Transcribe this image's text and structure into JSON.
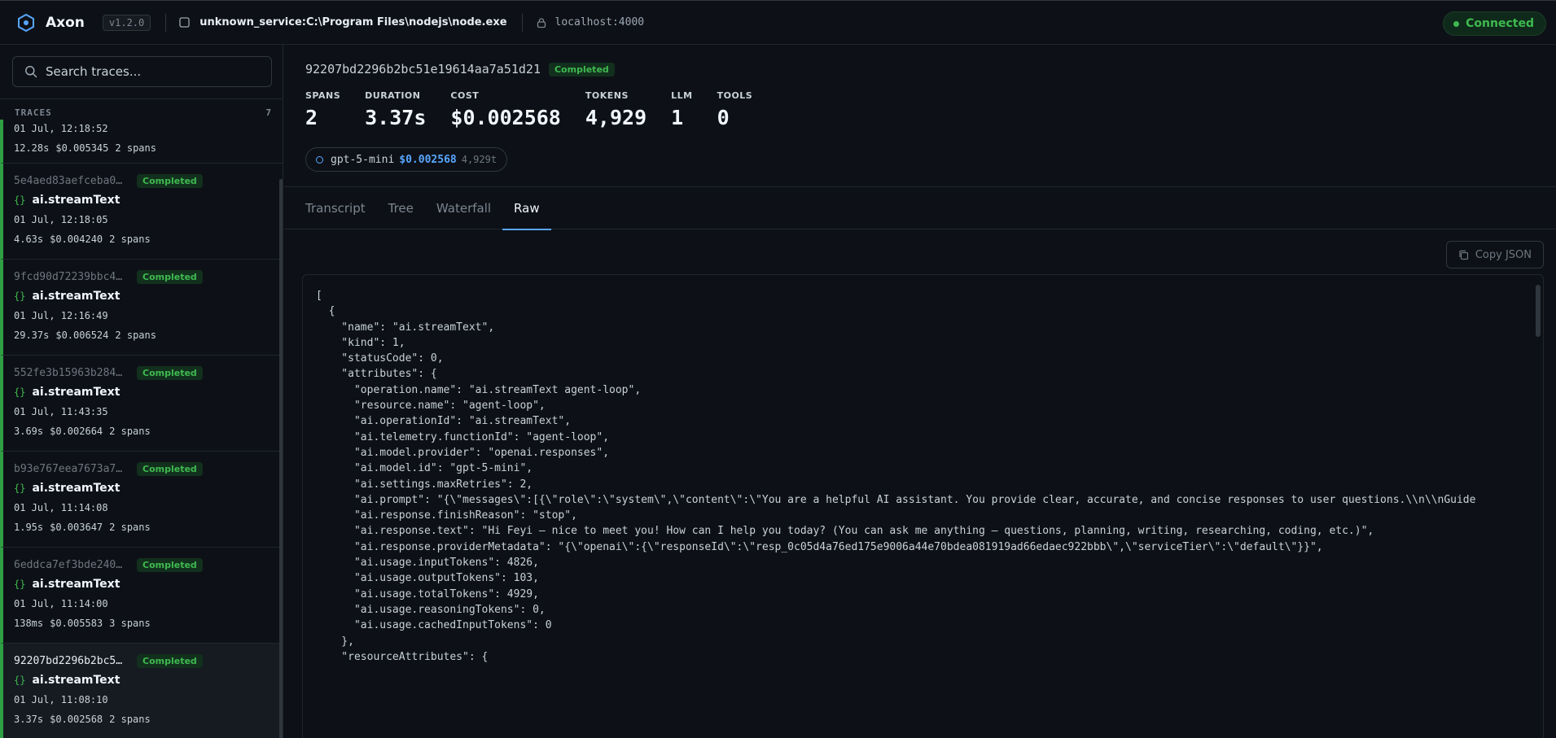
{
  "header": {
    "app_name": "Axon",
    "version": "v1.2.0",
    "service": "unknown_service:C:\\Program Files\\nodejs\\node.exe",
    "host": "localhost:4000",
    "connection_status": "Connected"
  },
  "sidebar": {
    "search_placeholder": "Search traces...",
    "traces_label": "TRACES",
    "traces_count": "7",
    "traces": [
      {
        "id": "",
        "status": "",
        "name": "",
        "time": "01 Jul, 12:18:52",
        "duration": "12.28s",
        "cost": "$0.005345",
        "spans": "2 spans"
      },
      {
        "id": "5e4aed83aefceba0…",
        "status": "Completed",
        "name": "ai.streamText",
        "time": "01 Jul, 12:18:05",
        "duration": "4.63s",
        "cost": "$0.004240",
        "spans": "2 spans"
      },
      {
        "id": "9fcd90d72239bbc4…",
        "status": "Completed",
        "name": "ai.streamText",
        "time": "01 Jul, 12:16:49",
        "duration": "29.37s",
        "cost": "$0.006524",
        "spans": "2 spans"
      },
      {
        "id": "552fe3b15963b284…",
        "status": "Completed",
        "name": "ai.streamText",
        "time": "01 Jul, 11:43:35",
        "duration": "3.69s",
        "cost": "$0.002664",
        "spans": "2 spans"
      },
      {
        "id": "b93e767eea7673a7…",
        "status": "Completed",
        "name": "ai.streamText",
        "time": "01 Jul, 11:14:08",
        "duration": "1.95s",
        "cost": "$0.003647",
        "spans": "2 spans"
      },
      {
        "id": "6eddca7ef3bde240…",
        "status": "Completed",
        "name": "ai.streamText",
        "time": "01 Jul, 11:14:00",
        "duration": "138ms",
        "cost": "$0.005583",
        "spans": "3 spans"
      },
      {
        "id": "92207bd2296b2bc5…",
        "status": "Completed",
        "name": "ai.streamText",
        "time": "01 Jul, 11:08:10",
        "duration": "3.37s",
        "cost": "$0.002568",
        "spans": "2 spans"
      }
    ]
  },
  "detail": {
    "trace_id": "92207bd2296b2bc51e19614aa7a51d21",
    "status": "Completed",
    "stats": [
      {
        "label": "SPANS",
        "value": "2"
      },
      {
        "label": "DURATION",
        "value": "3.37s"
      },
      {
        "label": "COST",
        "value": "$0.002568"
      },
      {
        "label": "TOKENS",
        "value": "4,929"
      },
      {
        "label": "LLM",
        "value": "1"
      },
      {
        "label": "TOOLS",
        "value": "0"
      }
    ],
    "model": {
      "name": "gpt-5-mini",
      "cost": "$0.002568",
      "tokens": "4,929t"
    },
    "tabs": [
      "Transcript",
      "Tree",
      "Waterfall",
      "Raw"
    ],
    "active_tab": "Raw",
    "copy_label": "Copy JSON",
    "raw_lines": [
      "[",
      "  {",
      "    \"name\": \"ai.streamText\",",
      "    \"kind\": 1,",
      "    \"statusCode\": 0,",
      "    \"attributes\": {",
      "      \"operation.name\": \"ai.streamText agent-loop\",",
      "      \"resource.name\": \"agent-loop\",",
      "      \"ai.operationId\": \"ai.streamText\",",
      "      \"ai.telemetry.functionId\": \"agent-loop\",",
      "      \"ai.model.provider\": \"openai.responses\",",
      "      \"ai.model.id\": \"gpt-5-mini\",",
      "      \"ai.settings.maxRetries\": 2,",
      "      \"ai.prompt\": \"{\\\"messages\\\":[{\\\"role\\\":\\\"system\\\",\\\"content\\\":\\\"You are a helpful AI assistant. You provide clear, accurate, and concise responses to user questions.\\\\n\\\\nGuide",
      "      \"ai.response.finishReason\": \"stop\",",
      "      \"ai.response.text\": \"Hi Feyi — nice to meet you! How can I help you today? (You can ask me anything — questions, planning, writing, researching, coding, etc.)\",",
      "      \"ai.response.providerMetadata\": \"{\\\"openai\\\":{\\\"responseId\\\":\\\"resp_0c05d4a76ed175e9006a44e70bdea081919ad66edaec922bbb\\\",\\\"serviceTier\\\":\\\"default\\\"}}\",",
      "      \"ai.usage.inputTokens\": 4826,",
      "      \"ai.usage.outputTokens\": 103,",
      "      \"ai.usage.totalTokens\": 4929,",
      "      \"ai.usage.reasoningTokens\": 0,",
      "      \"ai.usage.cachedInputTokens\": 0",
      "    },",
      "    \"resourceAttributes\": {"
    ]
  },
  "colors": {
    "accent": "#58a6ff",
    "success": "#3fb950",
    "background": "#0d1117"
  },
  "icons": {
    "logo": "hexagon-logo-icon",
    "service": "window-icon",
    "host": "lock-icon",
    "search": "search-icon",
    "copy": "copy-icon",
    "model": "circle-dot-icon",
    "trace_name": "braces-icon"
  }
}
